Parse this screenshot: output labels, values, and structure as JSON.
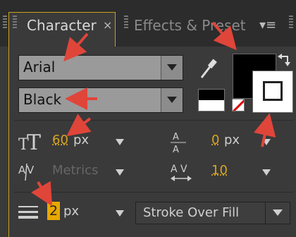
{
  "tabs": [
    {
      "label": "Character",
      "close": "×"
    },
    {
      "label": "Effects & Preset"
    }
  ],
  "tab_menu_icon": "▾≡",
  "font_family": {
    "value": "Arial"
  },
  "font_style": {
    "value": "Black"
  },
  "font_size": {
    "value": "60",
    "unit": "px"
  },
  "leading": {
    "value": "0",
    "unit": "px"
  },
  "kerning": {
    "value": "Metrics"
  },
  "tracking": {
    "value": "10"
  },
  "stroke_width": {
    "value": "2",
    "unit": "px"
  },
  "stroke_mode": {
    "value": "Stroke Over Fill"
  },
  "colors": {
    "fill": "#000000",
    "stroke": "#ffffff",
    "accent": "#d9a520",
    "annotation": "#e0453a"
  },
  "icons": [
    "eyedropper-icon",
    "swap-colors-icon",
    "font-size-icon",
    "leading-icon",
    "kerning-icon",
    "tracking-icon",
    "stroke-width-icon"
  ]
}
